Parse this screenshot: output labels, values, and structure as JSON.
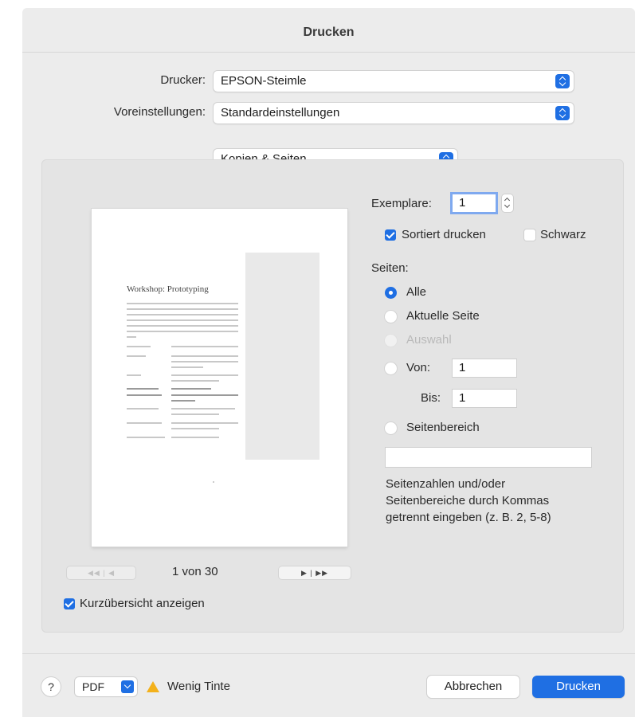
{
  "window": {
    "title": "Drucken"
  },
  "printer": {
    "label": "Drucker:",
    "value": "EPSON-Steimle"
  },
  "presets": {
    "label": "Voreinstellungen:",
    "value": "Standardeinstellungen"
  },
  "section": {
    "value": "Kopien & Seiten"
  },
  "preview": {
    "doc_title": "Workshop: Prototyping",
    "page_indicator": "1 von 30",
    "back_buttons": "◀◀ | ◀",
    "forward_buttons": "▶ | ▶▶",
    "show_preview_label": "Kurzübersicht anzeigen",
    "show_preview_checked": true
  },
  "copies": {
    "label": "Exemplare:",
    "value": "1"
  },
  "collate": {
    "label": "Sortiert drucken",
    "checked": true
  },
  "bw": {
    "label": "Schwarz",
    "checked": false
  },
  "pages": {
    "label": "Seiten:",
    "all": "Alle",
    "current": "Aktuelle Seite",
    "selection": "Auswahl",
    "from_label": "Von:",
    "from_value": "1",
    "to_label": "Bis:",
    "to_value": "1",
    "range_label": "Seitenbereich",
    "range_value": "",
    "hint_line1": "Seitenzahlen und/oder",
    "hint_line2": "Seitenbereiche durch Kommas",
    "hint_line3": "getrennt eingeben (z. B. 2, 5-8)"
  },
  "footer": {
    "help": "?",
    "pdf": "PDF",
    "ink_warning": "Wenig Tinte",
    "cancel": "Abbrechen",
    "print": "Drucken"
  },
  "colors": {
    "accent": "#1f6fe3",
    "warning": "#f3b11b",
    "background": "#ececec"
  },
  "icons": {
    "help": "help-icon",
    "warning": "warning-triangle-icon",
    "popup": "popup-chevron-icon"
  }
}
